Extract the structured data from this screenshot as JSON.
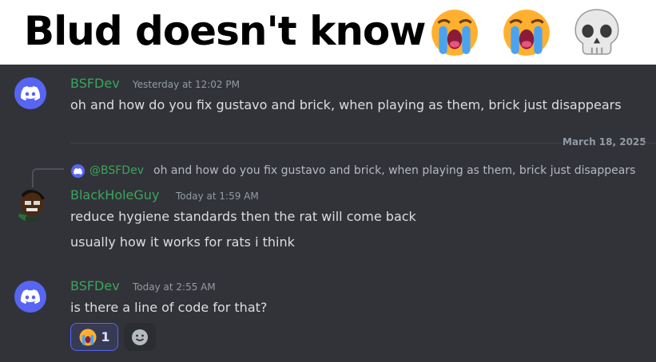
{
  "caption": {
    "text": "Blud doesn't know"
  },
  "messages": [
    {
      "author": "BSFDev",
      "timestamp": "Yesterday at 12:02 PM",
      "lines": [
        "oh and how do you fix gustavo and brick, when playing as them, brick just disappears"
      ]
    },
    {
      "author": "BlackHoleGuy",
      "timestamp": "Today at 1:59 AM",
      "reply": {
        "mention": "@BSFDev",
        "text": "oh and how do you fix gustavo and brick, when playing as them, brick just disappears"
      },
      "lines": [
        "reduce hygiene standards then the rat will come back",
        "usually how it works for rats i think"
      ]
    },
    {
      "author": "BSFDev",
      "timestamp": "Today at 2:55 AM",
      "lines": [
        "is there a line of code for that?"
      ],
      "reactions": [
        {
          "emoji": "loudly-crying-face",
          "count": "1"
        }
      ]
    }
  ],
  "date_divider": "March 18, 2025",
  "colors": {
    "background": "#313338",
    "username": "#3ba55d",
    "text": "#dbdee1",
    "muted": "#949ba4",
    "blurple": "#5865f2"
  }
}
